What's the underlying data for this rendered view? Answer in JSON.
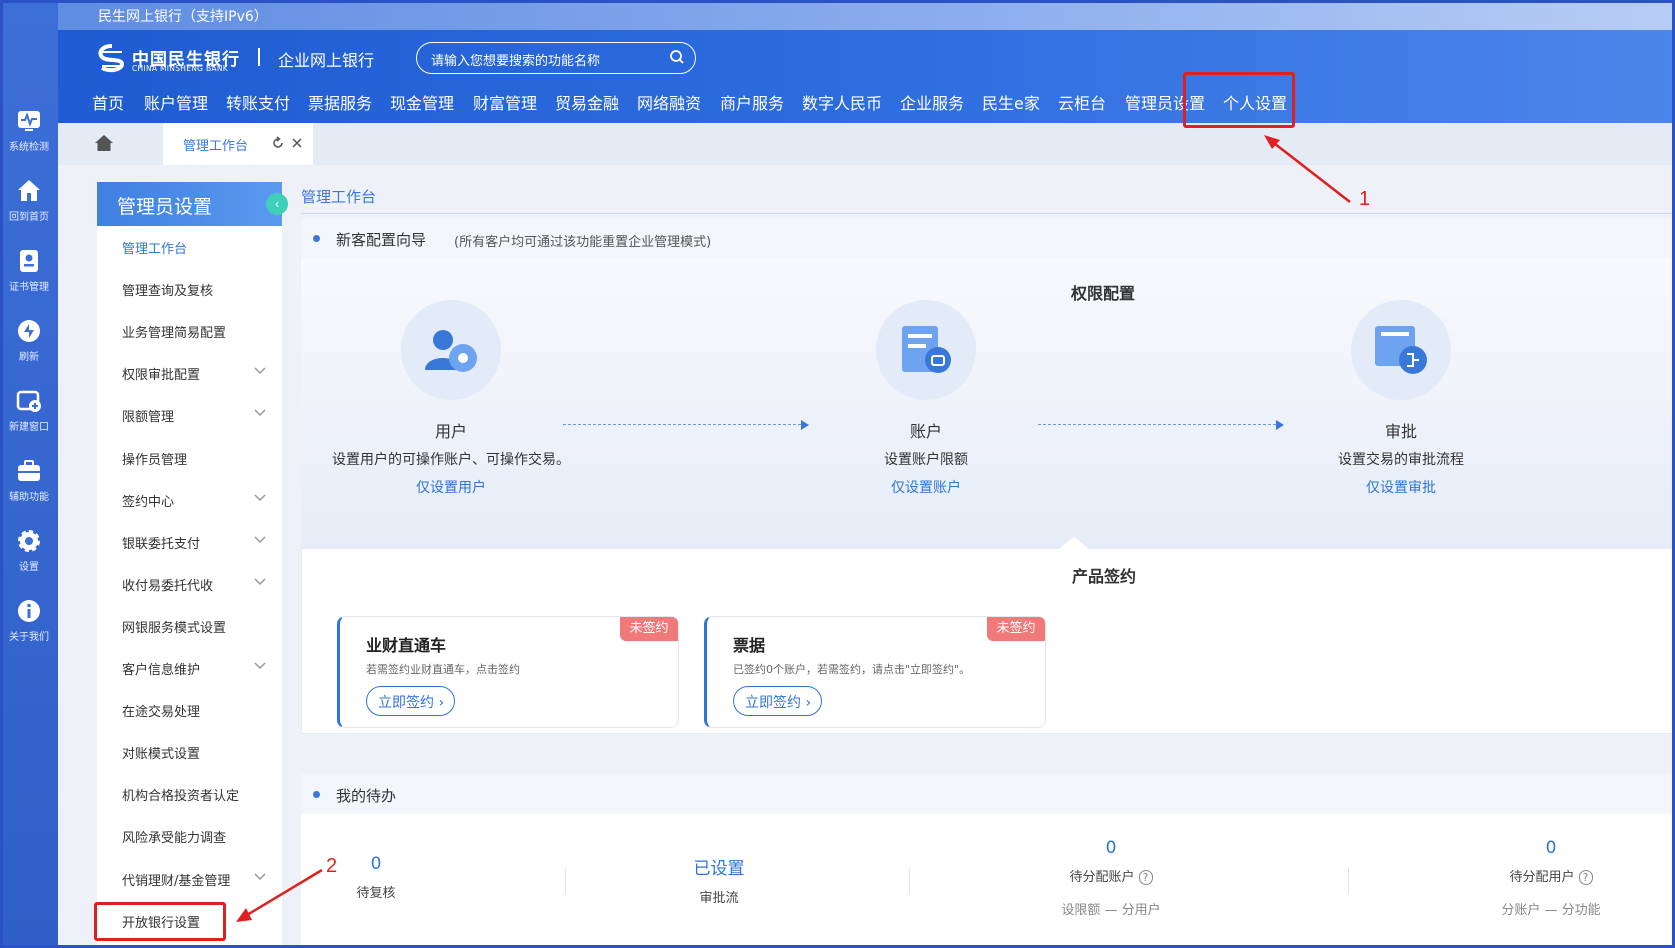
{
  "window": {
    "title": "民生网上银行（支持IPv6）"
  },
  "rail": [
    {
      "icon": "pulse-icon",
      "label": "系统检测"
    },
    {
      "icon": "home-icon",
      "label": "回到首页"
    },
    {
      "icon": "certificate-icon",
      "label": "证书管理"
    },
    {
      "icon": "refresh-icon",
      "label": "刷新"
    },
    {
      "icon": "new-window-icon",
      "label": "新建窗口"
    },
    {
      "icon": "toolbox-icon",
      "label": "辅助功能"
    },
    {
      "icon": "gear-icon",
      "label": "设置"
    },
    {
      "icon": "info-icon",
      "label": "关于我们"
    }
  ],
  "header": {
    "bank_name_cn": "中国民生银行",
    "bank_name_en": "CHINA MINSHENG BANK",
    "product": "企业网上银行",
    "search_placeholder": "请输入您想要搜索的功能名称",
    "nav": [
      "首页",
      "账户管理",
      "转账支付",
      "票据服务",
      "现金管理",
      "财富管理",
      "贸易金融",
      "网络融资",
      "商户服务",
      "数字人民币",
      "企业服务",
      "民生e家",
      "云柜台",
      "管理员设置",
      "个人设置"
    ]
  },
  "tabs": {
    "active_label": "管理工作台"
  },
  "sidebar": {
    "title": "管理员设置",
    "items": [
      {
        "label": "管理工作台",
        "expandable": false,
        "active": true
      },
      {
        "label": "管理查询及复核",
        "expandable": false
      },
      {
        "label": "业务管理简易配置",
        "expandable": false
      },
      {
        "label": "权限审批配置",
        "expandable": true
      },
      {
        "label": "限额管理",
        "expandable": true
      },
      {
        "label": "操作员管理",
        "expandable": false
      },
      {
        "label": "签约中心",
        "expandable": true
      },
      {
        "label": "银联委托支付",
        "expandable": true
      },
      {
        "label": "收付易委托代收",
        "expandable": true
      },
      {
        "label": "网银服务模式设置",
        "expandable": false
      },
      {
        "label": "客户信息维护",
        "expandable": true
      },
      {
        "label": "在途交易处理",
        "expandable": false
      },
      {
        "label": "对账模式设置",
        "expandable": false
      },
      {
        "label": "机构合格投资者认定",
        "expandable": false
      },
      {
        "label": "风险承受能力调查",
        "expandable": false
      },
      {
        "label": "代销理财/基金管理",
        "expandable": true
      },
      {
        "label": "开放银行设置",
        "expandable": false
      }
    ]
  },
  "main": {
    "page_title": "管理工作台",
    "guide": {
      "title": "新客配置向导",
      "note": "(所有客户均可通过该功能重置企业管理模式)",
      "perm_title": "权限配置",
      "steps": [
        {
          "title": "用户",
          "desc": "设置用户的可操作账户、可操作交易。",
          "link": "仅设置用户"
        },
        {
          "title": "账户",
          "desc": "设置账户限额",
          "link": "仅设置账户"
        },
        {
          "title": "审批",
          "desc": "设置交易的审批流程",
          "link": "仅设置审批"
        }
      ],
      "product_title": "产品签约",
      "cards": [
        {
          "title": "业财直通车",
          "desc": "若需签约业财直通车，点击签约",
          "button": "立即签约",
          "badge": "未签约"
        },
        {
          "title": "票据",
          "desc": "已签约0个账户，若需签约，请点击\"立即签约\"。",
          "button": "立即签约",
          "badge": "未签约"
        }
      ]
    },
    "todo": {
      "title": "我的待办",
      "items": [
        {
          "value": "0",
          "label": "待复核",
          "sub": ""
        },
        {
          "value": "已设置",
          "label": "审批流",
          "sub": ""
        },
        {
          "value": "0",
          "label": "待分配账户",
          "sub": "设限额 — 分用户"
        },
        {
          "value": "0",
          "label": "待分配用户",
          "sub": "分账户 — 分功能"
        }
      ]
    }
  },
  "annotations": {
    "step1": "1",
    "step2": "2",
    "color": "#e02020"
  }
}
